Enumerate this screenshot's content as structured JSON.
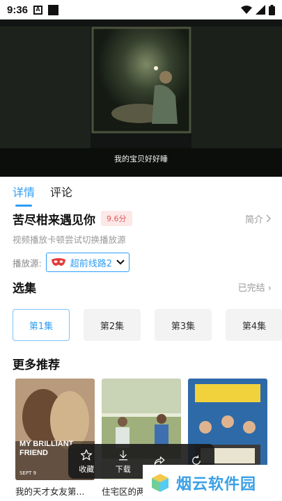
{
  "status_bar": {
    "time": "9:36",
    "a_badge": "A"
  },
  "video": {
    "subtitle": "我的宝贝好好睡"
  },
  "tabs": [
    {
      "label": "详情",
      "active": true
    },
    {
      "label": "评论",
      "active": false
    }
  ],
  "detail": {
    "title": "苦尽柑来遇见你",
    "score": "9.6分",
    "intro_label": "简介",
    "hint": "视频播放卡顿尝试切换播放源",
    "source_label": "播放源:",
    "source_value": "超前线路2"
  },
  "episodes": {
    "title": "选集",
    "status": "已完结",
    "items": [
      {
        "label": "第1集",
        "active": true
      },
      {
        "label": "第2集"
      },
      {
        "label": "第3集"
      },
      {
        "label": "第4集"
      }
    ]
  },
  "recommendations": {
    "title": "更多推荐",
    "items": [
      {
        "title": "我的天才女友第...",
        "poster_text": "MY BRILLIANT FRIEND",
        "poster_footer": "SEPT 9"
      },
      {
        "title": "住宅区的两人"
      },
      {
        "title": ""
      }
    ]
  },
  "action_bar": [
    {
      "label": "收藏",
      "icon": "star-icon"
    },
    {
      "label": "下载",
      "icon": "download-icon"
    },
    {
      "label": "",
      "icon": "share-icon"
    },
    {
      "label": "",
      "icon": "refresh-icon"
    }
  ],
  "watermark": {
    "text": "烟云软件园"
  },
  "colors": {
    "accent": "#2f9df4",
    "score_bg": "#fde8e8",
    "score_text": "#e05a5a",
    "watermark": "#3aa0e6"
  }
}
